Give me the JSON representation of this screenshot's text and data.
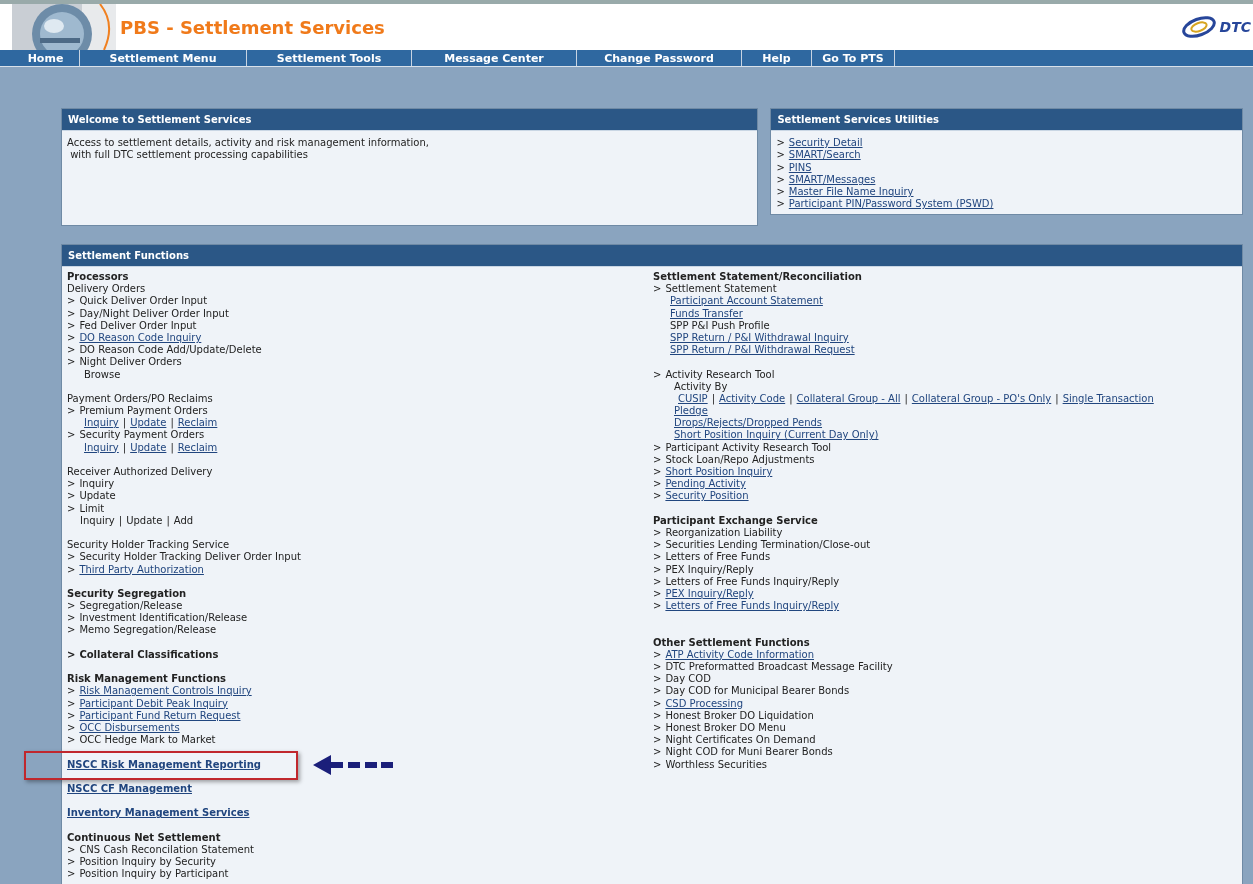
{
  "header": {
    "title": "PBS - Settlement Services",
    "logo_text": "DTC"
  },
  "nav": [
    {
      "label": "Home"
    },
    {
      "label": "Settlement Menu"
    },
    {
      "label": "Settlement Tools"
    },
    {
      "label": "Message Center"
    },
    {
      "label": "Change Password"
    },
    {
      "label": "Help"
    },
    {
      "label": "Go To PTS"
    }
  ],
  "welcome": {
    "title": "Welcome to Settlement Services",
    "lines": [
      "Access to settlement details, activity and risk management information,",
      "with full DTC settlement processing capabilities"
    ]
  },
  "utilities": {
    "title": "Settlement Services Utilities",
    "marker": ">",
    "links": [
      "Security Detail",
      "SMART/Search",
      "PINS",
      "SMART/Messages",
      "Master File Name Inquiry",
      "Participant PIN/Password System (PSWD)"
    ]
  },
  "functions": {
    "title": "Settlement Functions",
    "left": [
      {
        "kind": "heading",
        "parts": [
          {
            "text": "Processors",
            "link": false
          }
        ]
      },
      {
        "kind": "plain",
        "parts": [
          {
            "text": "Delivery Orders",
            "link": false
          }
        ]
      },
      {
        "kind": "item",
        "marker": ">",
        "parts": [
          {
            "text": "Quick Deliver Order Input",
            "link": false
          }
        ]
      },
      {
        "kind": "item",
        "marker": ">",
        "parts": [
          {
            "text": "Day/Night Deliver Order Input",
            "link": false
          }
        ]
      },
      {
        "kind": "item",
        "marker": ">",
        "parts": [
          {
            "text": "Fed Deliver Order Input",
            "link": false
          }
        ]
      },
      {
        "kind": "item",
        "marker": ">",
        "parts": [
          {
            "text": "DO Reason Code Inquiry",
            "link": true
          }
        ]
      },
      {
        "kind": "item",
        "marker": ">",
        "parts": [
          {
            "text": "DO Reason Code Add/Update/Delete",
            "link": false
          }
        ]
      },
      {
        "kind": "item",
        "marker": ">",
        "parts": [
          {
            "text": "Night Deliver Orders",
            "link": false
          }
        ]
      },
      {
        "kind": "sub",
        "parts": [
          {
            "text": "Browse",
            "link": false
          }
        ]
      },
      {
        "kind": "gap"
      },
      {
        "kind": "plain",
        "parts": [
          {
            "text": "Payment Orders/PO Reclaims",
            "link": false
          }
        ]
      },
      {
        "kind": "item",
        "marker": ">",
        "parts": [
          {
            "text": "Premium Payment Orders",
            "link": false
          }
        ]
      },
      {
        "kind": "sub",
        "parts": [
          {
            "text": "Inquiry",
            "link": true
          },
          {
            "text": "|",
            "link": false
          },
          {
            "text": "Update",
            "link": true
          },
          {
            "text": "|",
            "link": false
          },
          {
            "text": "Reclaim",
            "link": true
          }
        ]
      },
      {
        "kind": "item",
        "marker": ">",
        "parts": [
          {
            "text": "Security Payment Orders",
            "link": false
          }
        ]
      },
      {
        "kind": "sub",
        "parts": [
          {
            "text": "Inquiry",
            "link": true
          },
          {
            "text": "|",
            "link": false
          },
          {
            "text": "Update",
            "link": true
          },
          {
            "text": "|",
            "link": false
          },
          {
            "text": "Reclaim",
            "link": true
          }
        ]
      },
      {
        "kind": "gap"
      },
      {
        "kind": "plain",
        "parts": [
          {
            "text": "Receiver Authorized Delivery",
            "link": false
          }
        ]
      },
      {
        "kind": "item",
        "marker": ">",
        "parts": [
          {
            "text": "Inquiry",
            "link": false
          }
        ]
      },
      {
        "kind": "item",
        "marker": ">",
        "parts": [
          {
            "text": "Update",
            "link": false
          }
        ]
      },
      {
        "kind": "item",
        "marker": ">",
        "parts": [
          {
            "text": "Limit",
            "link": false
          }
        ]
      },
      {
        "kind": "subnarrow",
        "parts": [
          {
            "text": "Inquiry",
            "link": false
          },
          {
            "text": "|",
            "link": false
          },
          {
            "text": "Update",
            "link": false
          },
          {
            "text": "|",
            "link": false
          },
          {
            "text": "Add",
            "link": false
          }
        ]
      },
      {
        "kind": "gap"
      },
      {
        "kind": "plain",
        "parts": [
          {
            "text": "Security Holder Tracking Service",
            "link": false
          }
        ]
      },
      {
        "kind": "item",
        "marker": ">",
        "parts": [
          {
            "text": "Security Holder Tracking Deliver Order Input",
            "link": false
          }
        ]
      },
      {
        "kind": "item",
        "marker": ">",
        "parts": [
          {
            "text": "Third Party Authorization",
            "link": true
          }
        ]
      },
      {
        "kind": "gap"
      },
      {
        "kind": "heading",
        "parts": [
          {
            "text": "Security Segregation",
            "link": false
          }
        ]
      },
      {
        "kind": "item",
        "marker": ">",
        "parts": [
          {
            "text": "Segregation/Release",
            "link": false
          }
        ]
      },
      {
        "kind": "item",
        "marker": ">",
        "parts": [
          {
            "text": "Investment Identification/Release",
            "link": false
          }
        ]
      },
      {
        "kind": "item",
        "marker": ">",
        "parts": [
          {
            "text": "Memo Segregation/Release",
            "link": false
          }
        ]
      },
      {
        "kind": "gap"
      },
      {
        "kind": "heading",
        "marker": ">",
        "parts": [
          {
            "text": "Collateral Classifications",
            "link": false
          }
        ]
      },
      {
        "kind": "gap"
      },
      {
        "kind": "heading",
        "parts": [
          {
            "text": "Risk Management Functions",
            "link": false
          }
        ]
      },
      {
        "kind": "item",
        "marker": ">",
        "parts": [
          {
            "text": "Risk Management Controls Inquiry",
            "link": true
          }
        ]
      },
      {
        "kind": "item",
        "marker": ">",
        "parts": [
          {
            "text": "Participant Debit Peak Inquiry",
            "link": true
          }
        ]
      },
      {
        "kind": "item",
        "marker": ">",
        "parts": [
          {
            "text": "Participant Fund Return Request",
            "link": true
          }
        ]
      },
      {
        "kind": "item",
        "marker": ">",
        "parts": [
          {
            "text": "OCC Disbursements",
            "link": true
          }
        ]
      },
      {
        "kind": "item",
        "marker": ">",
        "parts": [
          {
            "text": "OCC Hedge Mark to Market",
            "link": false
          }
        ]
      },
      {
        "kind": "gap"
      },
      {
        "kind": "heading",
        "highlighted": true,
        "parts": [
          {
            "text": "NSCC Risk Management Reporting",
            "link": true
          }
        ]
      },
      {
        "kind": "gap"
      },
      {
        "kind": "heading",
        "highlighted": false,
        "parts": [
          {
            "text": "NSCC CF Management",
            "link": true
          }
        ]
      },
      {
        "kind": "gap"
      },
      {
        "kind": "heading",
        "highlighted": false,
        "parts": [
          {
            "text": "Inventory Management Services",
            "link": true
          }
        ]
      },
      {
        "kind": "gap"
      },
      {
        "kind": "heading",
        "parts": [
          {
            "text": "Continuous Net Settlement",
            "link": false
          }
        ]
      },
      {
        "kind": "item",
        "marker": ">",
        "parts": [
          {
            "text": "CNS Cash Reconcilation Statement",
            "link": false
          }
        ]
      },
      {
        "kind": "item",
        "marker": ">",
        "parts": [
          {
            "text": "Position Inquiry by Security",
            "link": false
          }
        ]
      },
      {
        "kind": "item",
        "marker": ">",
        "parts": [
          {
            "text": "Position Inquiry by Participant",
            "link": false
          }
        ]
      }
    ],
    "right": [
      {
        "kind": "heading",
        "parts": [
          {
            "text": "Settlement Statement/Reconciliation",
            "link": false
          }
        ]
      },
      {
        "kind": "item",
        "marker": ">",
        "parts": [
          {
            "text": "Settlement Statement",
            "link": false
          }
        ]
      },
      {
        "kind": "sub",
        "parts": [
          {
            "text": "Participant Account Statement",
            "link": true
          }
        ]
      },
      {
        "kind": "sub",
        "parts": [
          {
            "text": "Funds Transfer",
            "link": true
          }
        ]
      },
      {
        "kind": "sub",
        "parts": [
          {
            "text": "SPP P&I Push Profile",
            "link": false
          }
        ]
      },
      {
        "kind": "sub",
        "parts": [
          {
            "text": "SPP Return / P&I Withdrawal Inquiry",
            "link": true
          }
        ]
      },
      {
        "kind": "sub",
        "parts": [
          {
            "text": "SPP Return / P&I Withdrawal Request",
            "link": true
          }
        ]
      },
      {
        "kind": "gap"
      },
      {
        "kind": "item",
        "marker": ">",
        "parts": [
          {
            "text": "Activity Research Tool",
            "link": false
          }
        ]
      },
      {
        "kind": "sub2",
        "parts": [
          {
            "text": "Activity By",
            "link": false
          }
        ]
      },
      {
        "kind": "sub3",
        "parts": [
          {
            "text": "CUSIP",
            "link": true
          },
          {
            "text": "|",
            "link": false
          },
          {
            "text": "Activity Code",
            "link": true
          },
          {
            "text": "|",
            "link": false
          },
          {
            "text": "Collateral Group - All",
            "link": true
          },
          {
            "text": "|",
            "link": false
          },
          {
            "text": "Collateral Group - PO's Only",
            "link": true
          },
          {
            "text": "|",
            "link": false
          },
          {
            "text": "Single Transaction",
            "link": true
          }
        ]
      },
      {
        "kind": "sub2",
        "parts": [
          {
            "text": "Pledge",
            "link": true
          }
        ]
      },
      {
        "kind": "sub2",
        "parts": [
          {
            "text": "Drops/Rejects/Dropped Pends",
            "link": true
          }
        ]
      },
      {
        "kind": "sub2",
        "parts": [
          {
            "text": "Short Position Inquiry (Current Day Only)",
            "link": true
          }
        ]
      },
      {
        "kind": "item",
        "marker": ">",
        "parts": [
          {
            "text": "Participant Activity Research Tool",
            "link": false
          }
        ]
      },
      {
        "kind": "item",
        "marker": ">",
        "parts": [
          {
            "text": "Stock Loan/Repo Adjustments",
            "link": false
          }
        ]
      },
      {
        "kind": "item",
        "marker": ">",
        "parts": [
          {
            "text": "Short Position Inquiry",
            "link": true
          }
        ]
      },
      {
        "kind": "item",
        "marker": ">",
        "parts": [
          {
            "text": "Pending Activity",
            "link": true
          }
        ]
      },
      {
        "kind": "item",
        "marker": ">",
        "parts": [
          {
            "text": "Security Position",
            "link": true
          }
        ]
      },
      {
        "kind": "gap"
      },
      {
        "kind": "heading",
        "parts": [
          {
            "text": "Participant Exchange Service",
            "link": false
          }
        ]
      },
      {
        "kind": "item",
        "marker": ">",
        "parts": [
          {
            "text": "Reorganization Liability",
            "link": false
          }
        ]
      },
      {
        "kind": "item",
        "marker": ">",
        "parts": [
          {
            "text": "Securities Lending Termination/Close-out",
            "link": false
          }
        ]
      },
      {
        "kind": "item",
        "marker": ">",
        "parts": [
          {
            "text": "Letters of Free Funds",
            "link": false
          }
        ]
      },
      {
        "kind": "item",
        "marker": ">",
        "parts": [
          {
            "text": "PEX Inquiry/Reply",
            "link": false
          }
        ]
      },
      {
        "kind": "item",
        "marker": ">",
        "parts": [
          {
            "text": "Letters of Free Funds Inquiry/Reply",
            "link": false
          }
        ]
      },
      {
        "kind": "item",
        "marker": ">",
        "parts": [
          {
            "text": "PEX Inquiry/Reply",
            "link": true
          }
        ]
      },
      {
        "kind": "item",
        "marker": ">",
        "parts": [
          {
            "text": "Letters of Free Funds Inquiry/Reply",
            "link": true
          }
        ]
      },
      {
        "kind": "gap"
      },
      {
        "kind": "gap"
      },
      {
        "kind": "heading",
        "parts": [
          {
            "text": "Other Settlement Functions",
            "link": false
          }
        ]
      },
      {
        "kind": "item",
        "marker": ">",
        "parts": [
          {
            "text": "ATP Activity Code Information",
            "link": true
          }
        ]
      },
      {
        "kind": "item",
        "marker": ">",
        "parts": [
          {
            "text": "DTC Preformatted Broadcast Message Facility",
            "link": false
          }
        ]
      },
      {
        "kind": "item",
        "marker": ">",
        "parts": [
          {
            "text": "Day COD",
            "link": false
          }
        ]
      },
      {
        "kind": "item",
        "marker": ">",
        "parts": [
          {
            "text": "Day COD for Municipal Bearer Bonds",
            "link": false
          }
        ]
      },
      {
        "kind": "item",
        "marker": ">",
        "parts": [
          {
            "text": "CSD Processing",
            "link": true
          }
        ]
      },
      {
        "kind": "item",
        "marker": ">",
        "parts": [
          {
            "text": "Honest Broker DO Liquidation",
            "link": false
          }
        ]
      },
      {
        "kind": "item",
        "marker": ">",
        "parts": [
          {
            "text": "Honest Broker DO Menu",
            "link": false
          }
        ]
      },
      {
        "kind": "item",
        "marker": ">",
        "parts": [
          {
            "text": "Night Certificates On Demand",
            "link": false
          }
        ]
      },
      {
        "kind": "item",
        "marker": ">",
        "parts": [
          {
            "text": "Night COD for Muni Bearer Bonds",
            "link": false
          }
        ]
      },
      {
        "kind": "item",
        "marker": ">",
        "parts": [
          {
            "text": "Worthless Securities",
            "link": false
          }
        ]
      }
    ]
  }
}
